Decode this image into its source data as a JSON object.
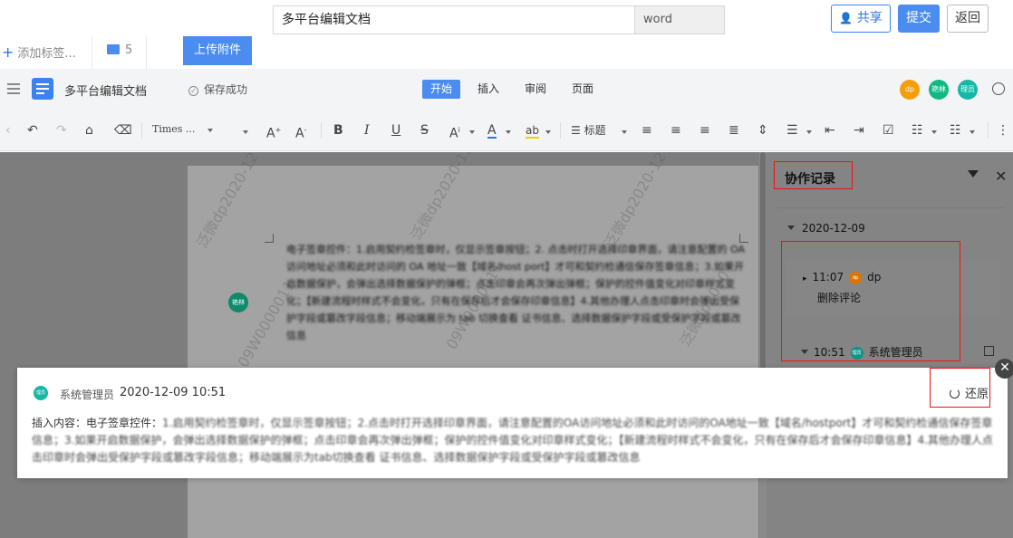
{
  "topbar": {
    "doc_title": "多平台编辑文档",
    "ext": "word",
    "share": "共享",
    "submit": "提交",
    "back": "返回"
  },
  "subbar": {
    "add_tag": "添加标签...",
    "attachments_count": "5",
    "upload": "上传附件"
  },
  "editor": {
    "doc_name": "多平台编辑文档",
    "save_status": "保存成功",
    "tabs": [
      "开始",
      "插入",
      "审阅",
      "页面"
    ],
    "avatars": [
      "dp",
      "艳林",
      "理员"
    ]
  },
  "toolbar": {
    "font": "Times ...",
    "heading": "标题"
  },
  "document": {
    "collab_avatar": "艳林",
    "paragraph": "电子签章控件：1.启用契约检签章时，仅显示签章按钮；2. 点击时打开选择印章界面，请注意配置的 OA 访问地址必须和此时访问的 OA 地址一致【域名/host port】才可和契约检通信保存签章信息；3.如果开启数据保护，会弹出选择数据保护的弹框；点击印章会再次弹出弹框；保护的控件值变化对印章样式变化；【新建流程时样式不会变化，只有在保存后才会保存印章信息】4.其他办理人点击印章时会弹出受保护字段或篡改字段信息；移动端展示为 tab 切换查看 证书信息、选择数据保护字段或受保护字段或篡改信息"
  },
  "panel": {
    "title": "协作记录",
    "date": "2020-12-09",
    "item1_time": "11:07",
    "item1_user": "dp",
    "item1_action": "删除评论",
    "item2_time": "10:51",
    "item2_user": "系统管理员"
  },
  "popup": {
    "avatar": "理员",
    "user": "系统管理员",
    "time": "2020-12-09 10:51",
    "restore": "还原",
    "content_label": "插入内容：电子签章控件：",
    "content_rest": "1.启用契约检签章时，仅显示签章按钮；2.点击时打开选择印章界面，请注意配置的OA访问地址必须和此时访问的OA地址一致【域名/hostport】才可和契约检通信保存签章信息；3.如果开启数据保护，会弹出选择数据保护的弹框；点击印章会再次弹出弹框；保护的控件值变化对印章样式变化；【新建流程时样式不会变化，只有在保存后才会保存印章信息】4.其他办理人点击印章时会弹出受保护字段或篡改字段信息；移动端展示为tab切换查看 证书信息、选择数据保护字段或受保护字段或篡改信息"
  }
}
